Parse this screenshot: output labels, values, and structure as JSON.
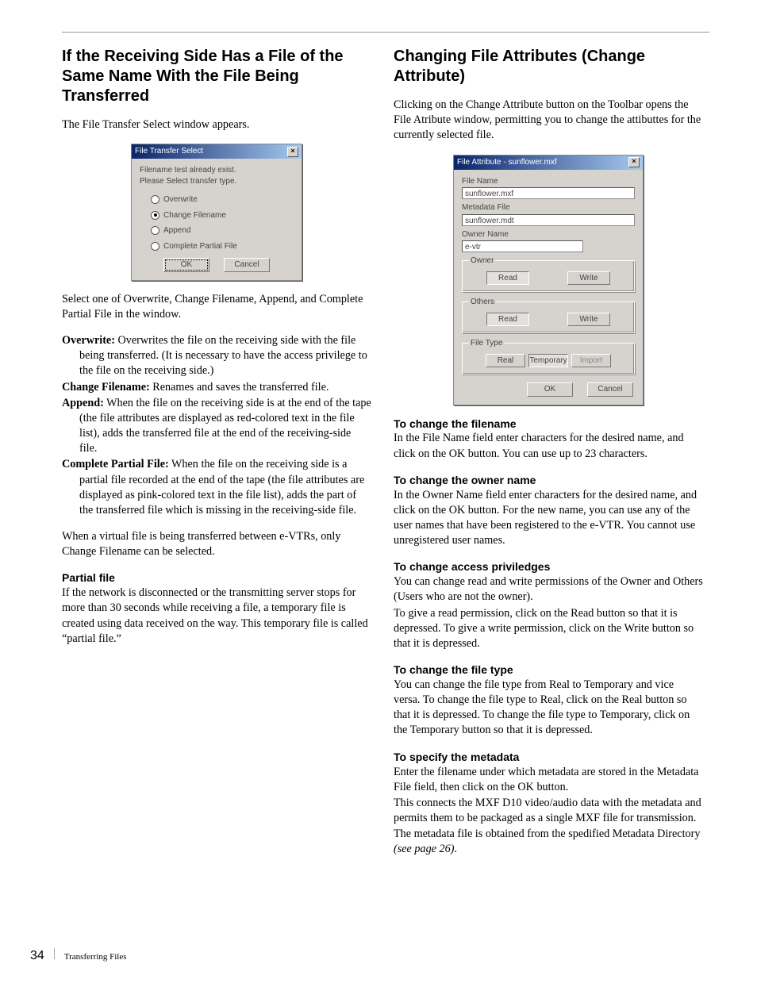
{
  "left": {
    "h2": "If the Receiving Side Has a File of the Same Name With the File Being Transferred",
    "intro": "The File Transfer Select window appears.",
    "after_win": "Select one of Overwrite, Change Filename, Append, and Complete Partial File in the window.",
    "defs": {
      "overwrite_t": "Overwrite:",
      "overwrite_d": " Overwrites the file on the receiving side with the file being transferred. (It is necessary to have the access privilege to the file on the receiving side.)",
      "change_t": "Change Filename:",
      "change_d": " Renames and saves the transferred file.",
      "append_t": "Append:",
      "append_d": " When the file on the receiving side is at the end of the tape (the file attributes are displayed as red-colored text in the file list), adds the transferred file at the end of the receiving-side file.",
      "complete_t": "Complete Partial File:",
      "complete_d": " When the file on the receiving side is a partial file recorded at the end of the tape (the file attributes are displayed as pink-colored text in the file list), adds the part of the transferred file which is missing in the receiving-side file."
    },
    "note_virtual": "When a virtual file is being transferred between e-VTRs, only Change Filename can be selected.",
    "partial_h": "Partial file",
    "partial_p": "If the network is disconnected or the transmitting server stops for more than 30 seconds while receiving a file, a temporary file is created using data received on the way. This temporary file is called “partial file.”"
  },
  "right": {
    "h2": "Changing File Attributes (Change Attribute)",
    "intro": "Clicking on the Change Attribute button on the Toolbar opens the File Atribute window, permitting you to change the attibuttes for the currently selected file.",
    "s1_h": "To change the filename",
    "s1_p": "In the File Name field enter characters for the desired name, and click on the OK button. You can use up to 23 characters.",
    "s2_h": "To change the owner name",
    "s2_p": "In the Owner Name field enter characters for the desired name, and click on the OK button. For the new name, you can use any of the user names that have been registered to the e-VTR. You cannot use unregistered user names.",
    "s3_h": "To change access priviledges",
    "s3_p1": "You can change read and write permissions of the Owner and Others (Users who are not the owner).",
    "s3_p2": "To give a read permission, click on the Read button so that it is depressed. To give a write permission, click on the Write button so that it is depressed.",
    "s4_h": "To change the file type",
    "s4_p": "You can change the file type from Real to Temporary and vice versa. To change the file type to Real, click on the Real button so that it is depressed. To change the file type to Temporary, click on the Temporary button so that it is depressed.",
    "s5_h": "To specify the metadata",
    "s5_p1": "Enter the filename under which metadata are stored in the Metadata File field, then click on the OK button.",
    "s5_p2": "This connects the MXF D10 video/audio data with the metadata and permits them to be packaged as a single MXF file for transmission.",
    "s5_p3a": "The metadata file is obtained from the spedified Metadata Directory ",
    "s5_p3b": "(see page 26)",
    "s5_p3c": "."
  },
  "win1": {
    "title": "File Transfer Select",
    "msg1": "Filename  test  already exist.",
    "msg2": "Please Select transfer type.",
    "r1": "Overwrite",
    "r2": "Change Filename",
    "r3": "Append",
    "r4": "Complete Partial File",
    "ok": "OK",
    "cancel": "Cancel"
  },
  "win2": {
    "title": "File Attribute - sunflower.mxf",
    "fn_l": "File Name",
    "fn_v": "sunflower.mxf",
    "mf_l": "Metadata File",
    "mf_v": "sunflower.mdt",
    "on_l": "Owner Name",
    "on_v": "e-vtr",
    "grp_owner": "Owner",
    "grp_others": "Others",
    "grp_type": "File Type",
    "read": "Read",
    "write": "Write",
    "real": "Real",
    "temp": "Temporary",
    "import": "Import",
    "ok": "OK",
    "cancel": "Cancel"
  },
  "footer": {
    "page": "34",
    "section": "Transferring Files"
  }
}
